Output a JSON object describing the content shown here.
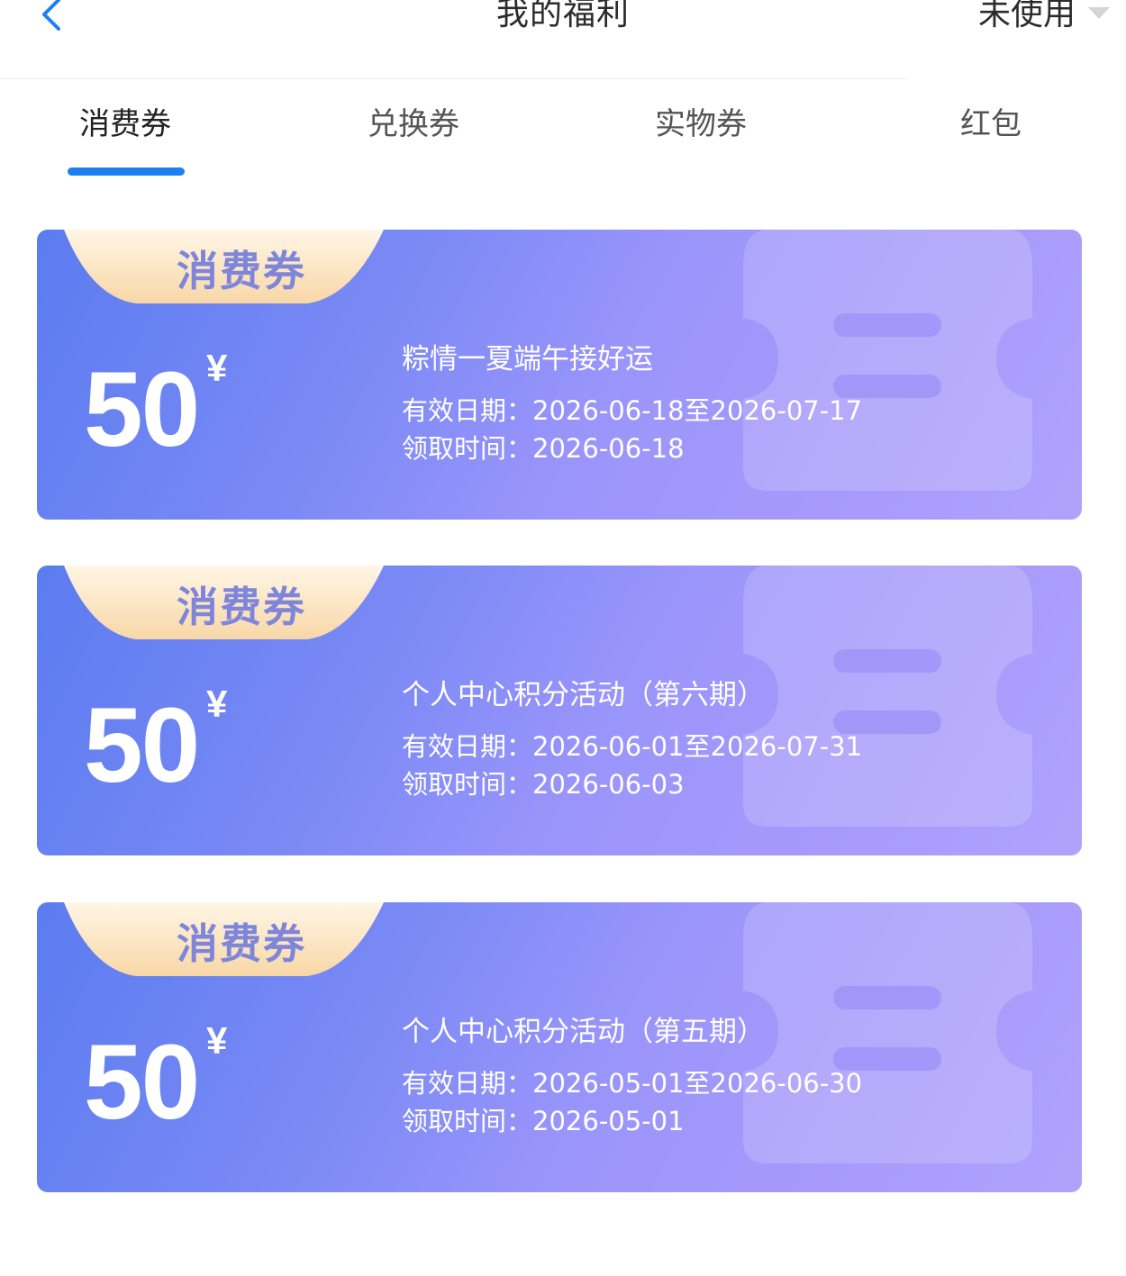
{
  "header": {
    "title": "我的福利",
    "filter_label": "未使用"
  },
  "tabs": [
    {
      "label": "消费券",
      "active": true
    },
    {
      "label": "兑换券",
      "active": false
    },
    {
      "label": "实物券",
      "active": false
    },
    {
      "label": "红包",
      "active": false
    }
  ],
  "coupons": [
    {
      "badge": "消费券",
      "amount": "50",
      "currency": "¥",
      "name": "粽情一夏端午接好运",
      "validity_label": "有效日期：",
      "validity": "2026-06-18至2026-07-17",
      "claim_label": "领取时间：",
      "claim_time": "2026-06-18"
    },
    {
      "badge": "消费券",
      "amount": "50",
      "currency": "¥",
      "name": "个人中心积分活动（第六期）",
      "validity_label": "有效日期：",
      "validity": "2026-06-01至2026-07-31",
      "claim_label": "领取时间：",
      "claim_time": "2026-06-03"
    },
    {
      "badge": "消费券",
      "amount": "50",
      "currency": "¥",
      "name": "个人中心积分活动（第五期）",
      "validity_label": "有效日期：",
      "validity": "2026-05-01至2026-06-30",
      "claim_label": "领取时间：",
      "claim_time": "2026-05-01"
    }
  ],
  "colors": {
    "accent": "#1f7ff0",
    "card_start": "#5b7cf0",
    "card_end": "#b0a2fc",
    "badge_text": "#7f86d9"
  }
}
